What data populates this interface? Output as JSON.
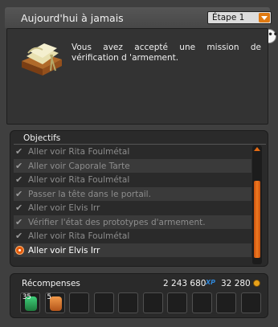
{
  "window": {
    "title": "Aujourd'hui à jamais",
    "step_select": "Étape 1",
    "more_button": "•••"
  },
  "description": {
    "text": "Vous avez accepté une mission de vérification d 'armement."
  },
  "objectives": {
    "title": "Objectifs",
    "items": [
      {
        "label": "Aller voir Rita Foulmétal",
        "done": true
      },
      {
        "label": "Aller voir Caporale Tarte",
        "done": true
      },
      {
        "label": "Aller voir Rita Foulmétal",
        "done": true
      },
      {
        "label": "Passer la tête dans le portail.",
        "done": true
      },
      {
        "label": "Aller voir Elvis Irr",
        "done": true
      },
      {
        "label": "Vérifier l'état des prototypes d'armement.",
        "done": true
      },
      {
        "label": "Aller voir Rita Foulmétal",
        "done": true
      },
      {
        "label": "Aller voir Elvis Irr",
        "done": false
      }
    ],
    "scroll_position": 1.0
  },
  "rewards": {
    "title": "Récompenses",
    "xp": "2 243 680",
    "xp_icon": "XP",
    "kamas": "32 280",
    "items": [
      {
        "icon": "potion-icon",
        "qty": "35"
      },
      {
        "icon": "scroll-item-icon",
        "qty": "5"
      }
    ],
    "empty_slots": 8
  },
  "colors": {
    "accent": "#e56a12",
    "panel": "#2a2a2a",
    "background": "#3f3f3f"
  }
}
